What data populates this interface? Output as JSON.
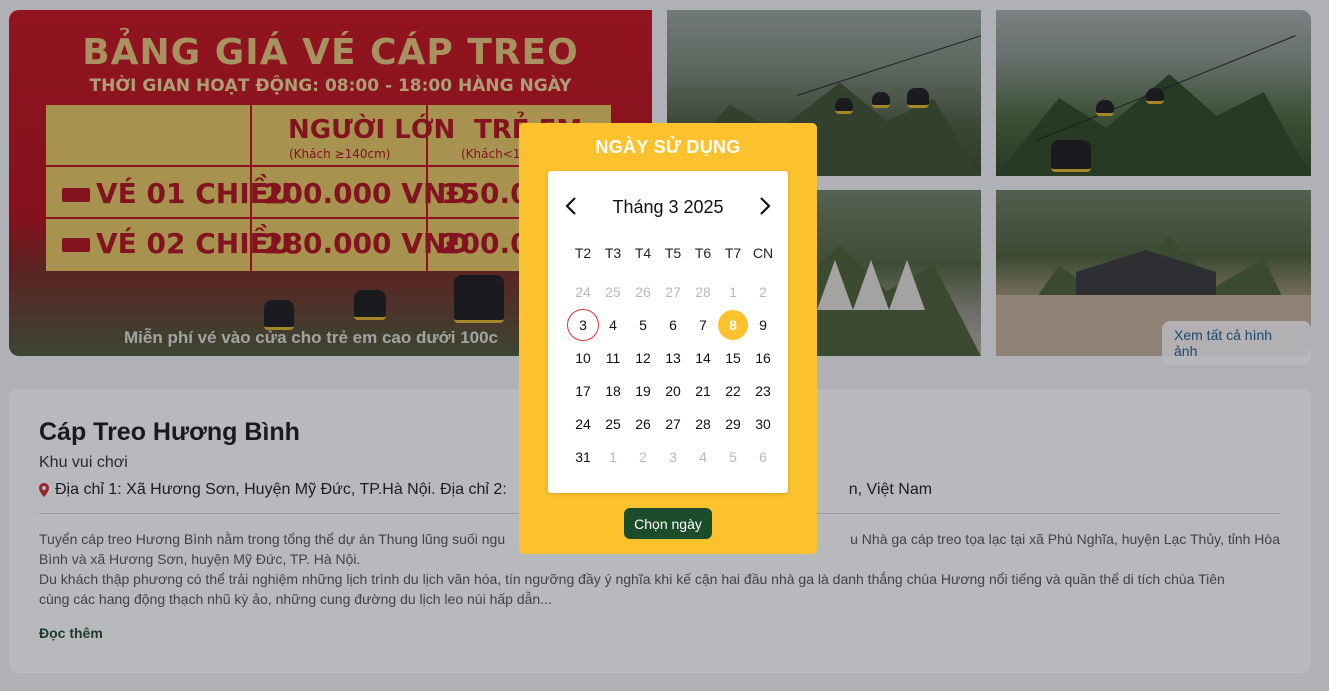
{
  "gallery": {
    "main": {
      "title": "BẢNG GIÁ VÉ CÁP TREO",
      "subtitle": "THỜI GIAN HOẠT ĐỘNG: 08:00 - 18:00 HÀNG NGÀY",
      "col_adult": "NGƯỜI LỚN",
      "col_adult_note": "(Khách ≥140cm)",
      "col_child": "TRẺ EM",
      "col_child_note": "(Khách<1",
      "row1_label": "VÉ 01 CHIỀU",
      "row1_adult": "200.000 VNĐ",
      "row1_child": "150.000",
      "row2_label": "VÉ 02 CHIỀU",
      "row2_adult": "280.000 VNĐ",
      "row2_child": "200.000",
      "footer": "Miễn phí vé vào cửa cho trẻ em cao dưới 100c"
    },
    "see_all_label": "Xem tất cả hình ảnh"
  },
  "place": {
    "name": "Cáp Treo Hương Bình",
    "category": "Khu vui chơi",
    "address": "Địa chỉ 1: Xã Hương Sơn, Huyện Mỹ Đức, TP.Hà Nội. Địa chỉ 2:",
    "address_tail": "n, Việt Nam",
    "desc_line1": "Tuyển cáp treo Hương Bình nằm trong tổng thể dự án Thung lũng suối ngu",
    "desc_line1_tail": "u Nhà ga cáp treo tọa lạc tại xã Phú Nghĩa, huyện Lạc Thủy, tỉnh Hòa",
    "desc_line2": "Bình và xã Hương Sơn, huyện Mỹ Đức, TP. Hà Nội.",
    "desc_line3": "Du khách thập phương có thể trải nghiệm những lịch trình du lịch văn hóa, tín ngưỡng đầy ý nghĩa khi kế cận hai đầu nhà ga là danh thắng chùa Hương nổi tiếng và quần thể di tích chùa Tiên",
    "desc_line4": "cùng các hang động thạch nhũ kỳ ảo, những cung đường du lịch leo núi hấp dẫn...",
    "read_more": "Đọc thêm"
  },
  "date_picker": {
    "title": "NGÀY SỬ DỤNG",
    "month_label": "Tháng 3  2025",
    "weekdays": [
      "T2",
      "T3",
      "T4",
      "T5",
      "T6",
      "T7",
      "CN"
    ],
    "weeks": [
      [
        {
          "d": "24",
          "m": true
        },
        {
          "d": "25",
          "m": true
        },
        {
          "d": "26",
          "m": true
        },
        {
          "d": "27",
          "m": true
        },
        {
          "d": "28",
          "m": true
        },
        {
          "d": "1",
          "m": true
        },
        {
          "d": "2",
          "m": true
        }
      ],
      [
        {
          "d": "3",
          "today": true
        },
        {
          "d": "4"
        },
        {
          "d": "5"
        },
        {
          "d": "6"
        },
        {
          "d": "7"
        },
        {
          "d": "8",
          "sel": true
        },
        {
          "d": "9"
        }
      ],
      [
        {
          "d": "10"
        },
        {
          "d": "11"
        },
        {
          "d": "12"
        },
        {
          "d": "13"
        },
        {
          "d": "14"
        },
        {
          "d": "15"
        },
        {
          "d": "16"
        }
      ],
      [
        {
          "d": "17"
        },
        {
          "d": "18"
        },
        {
          "d": "19"
        },
        {
          "d": "20"
        },
        {
          "d": "21"
        },
        {
          "d": "22"
        },
        {
          "d": "23"
        }
      ],
      [
        {
          "d": "24"
        },
        {
          "d": "25"
        },
        {
          "d": "26"
        },
        {
          "d": "27"
        },
        {
          "d": "28"
        },
        {
          "d": "29"
        },
        {
          "d": "30"
        }
      ],
      [
        {
          "d": "31"
        },
        {
          "d": "1",
          "m": true
        },
        {
          "d": "2",
          "m": true
        },
        {
          "d": "3",
          "m": true
        },
        {
          "d": "4",
          "m": true
        },
        {
          "d": "5",
          "m": true
        },
        {
          "d": "6",
          "m": true
        }
      ]
    ],
    "confirm_label": "Chọn ngày",
    "prev_icon": "chevron-left-icon",
    "next_icon": "chevron-right-icon"
  },
  "colors": {
    "accent": "#fbc22e",
    "button": "#1b4d2b",
    "today_ring": "#d9363e"
  }
}
